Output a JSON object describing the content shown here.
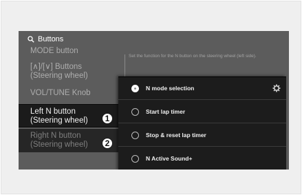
{
  "header": {
    "title": "Buttons",
    "search_icon": "search-icon"
  },
  "menu": {
    "partial_item": "MODE button",
    "arrows_item": [
      "[∧]/[∨] Buttons",
      "(Steering wheel)"
    ],
    "vol_item": "VOL/TUNE Knob",
    "left_n": [
      "Left N button",
      "(Steering wheel)"
    ],
    "right_n": [
      "Right N button",
      "(Steering wheel)"
    ]
  },
  "badges": {
    "one": "1",
    "two": "2"
  },
  "description": "Set the function for the N button on the steering wheel (left side).",
  "options": [
    {
      "label": "N mode selection",
      "selected": true
    },
    {
      "label": "Start lap timer",
      "selected": false
    },
    {
      "label": "Stop & reset lap timer",
      "selected": false
    },
    {
      "label": "N Active Sound+",
      "selected": false
    }
  ],
  "nav": {
    "back_icon": "back-icon",
    "home_icon": "home-icon",
    "menu_icon": "menu-icon"
  },
  "colors": {
    "screen": "#5c5c5c",
    "popup": "#1c1c1c",
    "selected_item": "#1b1b1b"
  }
}
